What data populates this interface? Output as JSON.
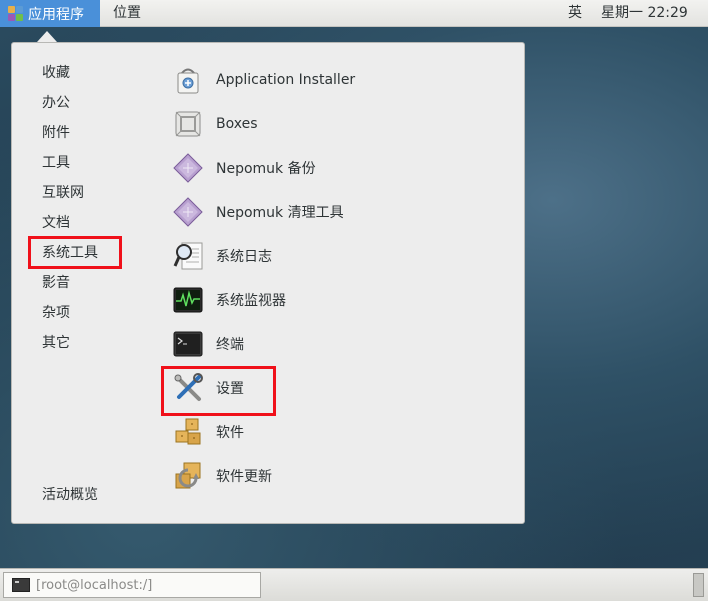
{
  "topbar": {
    "applications_label": "应用程序",
    "places_label": "位置",
    "input_method": "英",
    "clock": "星期一 22:29"
  },
  "menu": {
    "categories": [
      {
        "label": "收藏"
      },
      {
        "label": "办公"
      },
      {
        "label": "附件"
      },
      {
        "label": "工具"
      },
      {
        "label": "互联网"
      },
      {
        "label": "文档"
      },
      {
        "label": "系统工具",
        "highlighted": true
      },
      {
        "label": "影音"
      },
      {
        "label": "杂项"
      },
      {
        "label": "其它"
      }
    ],
    "activities_label": "活动概览",
    "apps": [
      {
        "label": "Application Installer",
        "icon": "application-installer-icon"
      },
      {
        "label": "Boxes",
        "icon": "boxes-icon"
      },
      {
        "label": "Nepomuk 备份",
        "icon": "nepomuk-backup-icon"
      },
      {
        "label": "Nepomuk 清理工具",
        "icon": "nepomuk-cleaner-icon"
      },
      {
        "label": "系统日志",
        "icon": "system-log-icon"
      },
      {
        "label": "系统监视器",
        "icon": "system-monitor-icon"
      },
      {
        "label": "终端",
        "icon": "terminal-icon"
      },
      {
        "label": "设置",
        "icon": "settings-icon",
        "highlighted": true
      },
      {
        "label": "软件",
        "icon": "software-icon"
      },
      {
        "label": "软件更新",
        "icon": "software-update-icon"
      }
    ],
    "highlight_color": "#f0101a"
  },
  "taskbar": {
    "window_label": "[root@localhost:/]"
  }
}
